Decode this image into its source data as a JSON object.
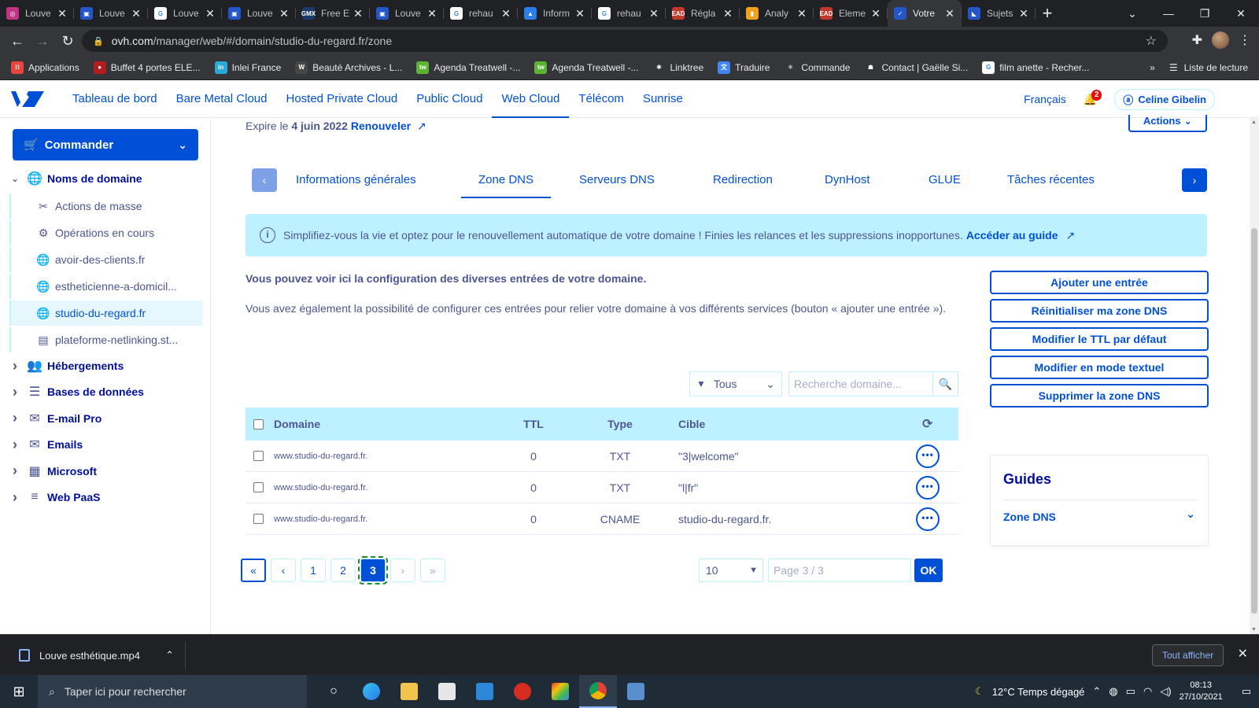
{
  "browser": {
    "tabs": [
      {
        "title": "Louve",
        "color": "#c13584",
        "glyph": "◎"
      },
      {
        "title": "Louve",
        "color": "#2456c7",
        "glyph": "▣"
      },
      {
        "title": "Louve",
        "color": "#ffffff",
        "glyph": "G"
      },
      {
        "title": "Louve",
        "color": "#2456c7",
        "glyph": "▣"
      },
      {
        "title": "Free E",
        "color": "#1a3a6b",
        "glyph": "GMX"
      },
      {
        "title": "Louve",
        "color": "#2456c7",
        "glyph": "▣"
      },
      {
        "title": "rehau",
        "color": "#ffffff",
        "glyph": "G"
      },
      {
        "title": "Inform",
        "color": "#2b7de9",
        "glyph": "▲"
      },
      {
        "title": "rehau",
        "color": "#ffffff",
        "glyph": "G"
      },
      {
        "title": "Régla",
        "color": "#c0392b",
        "glyph": "EAD"
      },
      {
        "title": "Analy",
        "color": "#f4a21b",
        "glyph": "▮"
      },
      {
        "title": "Eleme",
        "color": "#c0392b",
        "glyph": "EAD"
      },
      {
        "title": "Votre",
        "color": "#2456c7",
        "glyph": "✓"
      },
      {
        "title": "Sujets",
        "color": "#2456c7",
        "glyph": "◣"
      }
    ],
    "active_tab_index": 12,
    "url_host": "ovh.com",
    "url_path": "/manager/web/#/domain/studio-du-regard.fr/zone"
  },
  "bookmarks": {
    "items": [
      {
        "label": "Applications",
        "color": "#e8453c",
        "glyph": "⁝⁝"
      },
      {
        "label": "Buffet 4 portes ELE...",
        "color": "#b31d1d",
        "glyph": "●"
      },
      {
        "label": "Inlei France",
        "color": "#2aa8d6",
        "glyph": "in"
      },
      {
        "label": "Beauté Archives - L...",
        "color": "#464646",
        "glyph": "W"
      },
      {
        "label": "Agenda Treatwell -...",
        "color": "#5bb532",
        "glyph": "tw"
      },
      {
        "label": "Agenda Treatwell -...",
        "color": "#5bb532",
        "glyph": "tw"
      },
      {
        "label": "Linktree",
        "color": "#35363a",
        "glyph": "✱"
      },
      {
        "label": "Traduire",
        "color": "#4285f4",
        "glyph": "文"
      },
      {
        "label": "Commande",
        "color": "#35363a",
        "glyph": "✳"
      },
      {
        "label": "Contact | Gaëlle Si...",
        "color": "#35363a",
        "glyph": "☗"
      },
      {
        "label": "film anette - Recher...",
        "color": "#ffffff",
        "glyph": "G"
      }
    ],
    "more": "»",
    "reading_list": "Liste de lecture"
  },
  "ovh_nav": {
    "items": [
      "Tableau de bord",
      "Bare Metal Cloud",
      "Hosted Private Cloud",
      "Public Cloud",
      "Web Cloud",
      "Télécom",
      "Sunrise"
    ],
    "active_index": 4,
    "language": "Français",
    "notifications": "2",
    "user": "Celine Gibelin"
  },
  "sidebar": {
    "order_button": "Commander",
    "domains_section": "Noms de domaine",
    "domain_items": [
      {
        "label": "Actions de masse",
        "icon": "✂"
      },
      {
        "label": "Opérations en cours",
        "icon": "⚙"
      },
      {
        "label": "avoir-des-clients.fr",
        "icon": "🌐"
      },
      {
        "label": "estheticienne-a-domicil...",
        "icon": "🌐"
      },
      {
        "label": "studio-du-regard.fr",
        "icon": "🌐"
      },
      {
        "label": "plateforme-netlinking.st...",
        "icon": "▤"
      }
    ],
    "selected_domain_index": 4,
    "sections": [
      {
        "label": "Hébergements",
        "icon": "👥"
      },
      {
        "label": "Bases de données",
        "icon": "☰"
      },
      {
        "label": "E-mail Pro",
        "icon": "✉"
      },
      {
        "label": "Emails",
        "icon": "✉"
      },
      {
        "label": "Microsoft",
        "icon": "▦"
      },
      {
        "label": "Web PaaS",
        "icon": "≡"
      }
    ]
  },
  "main": {
    "expire_prefix": "Expire le",
    "expire_date": "4 juin 2022",
    "renew_label": "Renouveler",
    "actions_label": "Actions",
    "tabs": [
      "Informations générales",
      "Zone DNS",
      "Serveurs DNS",
      "Redirection",
      "DynHost",
      "GLUE",
      "Tâches récentes"
    ],
    "active_tab_index": 1,
    "banner_text": "Simplifiez-vous la vie et optez pour le renouvellement automatique de votre domaine ! Finies les relances et les suppressions inopportunes.",
    "banner_link": "Accéder au guide",
    "desc_title": "Vous pouvez voir ici la configuration des diverses entrées de votre domaine.",
    "desc_text": "Vous avez également la possibilité de configurer ces entrées pour relier votre domaine à vos différents services (bouton « ajouter une entrée »).",
    "action_buttons": [
      "Ajouter une entrée",
      "Réinitialiser ma zone DNS",
      "Modifier le TTL par défaut",
      "Modifier en mode textuel",
      "Supprimer la zone DNS"
    ],
    "guides_title": "Guides",
    "guides_item": "Zone DNS",
    "filter_value": "Tous",
    "search_placeholder": "Recherche domaine...",
    "table": {
      "headers": {
        "domain": "Domaine",
        "ttl": "TTL",
        "type": "Type",
        "target": "Cible"
      },
      "rows": [
        {
          "domain": "www.studio-du-regard.fr.",
          "ttl": "0",
          "type": "TXT",
          "target": "\"3|welcome\""
        },
        {
          "domain": "www.studio-du-regard.fr.",
          "ttl": "0",
          "type": "TXT",
          "target": "\"l|fr\""
        },
        {
          "domain": "www.studio-du-regard.fr.",
          "ttl": "0",
          "type": "CNAME",
          "target": "studio-du-regard.fr."
        }
      ]
    },
    "pagination": {
      "pages": [
        "1",
        "2",
        "3"
      ],
      "current": "3",
      "per_page": "10",
      "page_placeholder": "Page 3 / 3",
      "ok_label": "OK"
    }
  },
  "downloads": {
    "file": "Louve esthétique.mp4",
    "show_all": "Tout afficher"
  },
  "taskbar": {
    "search_placeholder": "Taper ici pour rechercher",
    "weather": "12°C  Temps dégagé",
    "time": "08:13",
    "date": "27/10/2021"
  }
}
